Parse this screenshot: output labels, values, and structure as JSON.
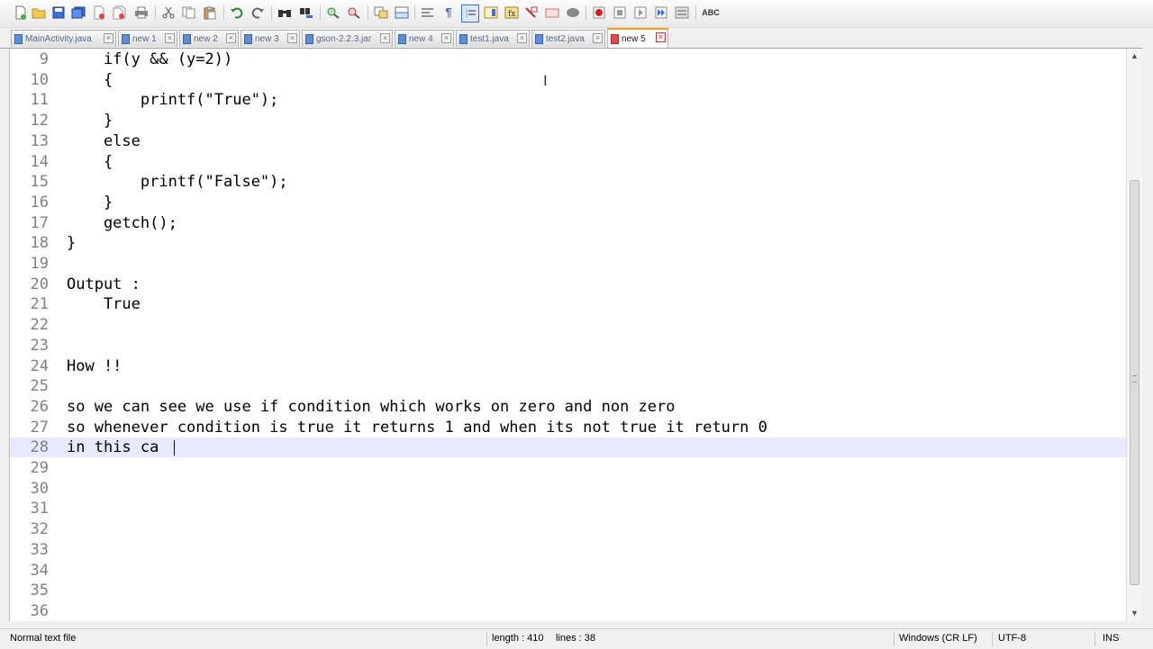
{
  "toolbar": {
    "icons": [
      "new-file-icon",
      "open-file-icon",
      "save-icon",
      "save-all-icon",
      "close-icon",
      "close-all-icon",
      "print-icon",
      "cut-icon",
      "copy-icon",
      "paste-icon",
      "undo-icon",
      "redo-icon",
      "find-icon",
      "replace-icon",
      "zoom-in-icon",
      "zoom-out-icon",
      "sync-vertical-icon",
      "sync-horizontal-icon",
      "word-wrap-icon",
      "show-all-chars-icon",
      "indent-guide-icon",
      "doc-map-icon",
      "function-list-icon",
      "folder-workspace-icon",
      "monitoring-icon",
      "macro-record-icon",
      "macro-stop-icon",
      "macro-play-icon",
      "macro-run-multiple-icon",
      "macro-save-icon",
      "spell-check-icon"
    ],
    "spell_label": "ABC"
  },
  "tabs": [
    {
      "label": "MainActivity.java",
      "active": false
    },
    {
      "label": "new 1",
      "active": false
    },
    {
      "label": "new 2",
      "active": false
    },
    {
      "label": "new 3",
      "active": false
    },
    {
      "label": "gson-2.2.3.jar",
      "active": false
    },
    {
      "label": "new 4",
      "active": false
    },
    {
      "label": "test1.java",
      "active": false
    },
    {
      "label": "test2.java",
      "active": false
    },
    {
      "label": "new 5",
      "active": true
    }
  ],
  "editor": {
    "lines": [
      {
        "n": "9",
        "text": "    if(y && (y=2))"
      },
      {
        "n": "10",
        "text": "    {"
      },
      {
        "n": "11",
        "text": "        printf(\"True\");"
      },
      {
        "n": "12",
        "text": "    }"
      },
      {
        "n": "13",
        "text": "    else"
      },
      {
        "n": "14",
        "text": "    {"
      },
      {
        "n": "15",
        "text": "        printf(\"False\");"
      },
      {
        "n": "16",
        "text": "    }"
      },
      {
        "n": "17",
        "text": "    getch();"
      },
      {
        "n": "18",
        "text": "}"
      },
      {
        "n": "19",
        "text": ""
      },
      {
        "n": "20",
        "text": "Output :"
      },
      {
        "n": "21",
        "text": "    True"
      },
      {
        "n": "22",
        "text": ""
      },
      {
        "n": "23",
        "text": ""
      },
      {
        "n": "24",
        "text": "How !!"
      },
      {
        "n": "25",
        "text": ""
      },
      {
        "n": "26",
        "text": "so we can see we use if condition which works on zero and non zero"
      },
      {
        "n": "27",
        "text": "so whenever condition is true it returns 1 and when its not true it return 0"
      },
      {
        "n": "28",
        "text": "in this ca"
      },
      {
        "n": "29",
        "text": ""
      },
      {
        "n": "30",
        "text": ""
      },
      {
        "n": "31",
        "text": ""
      },
      {
        "n": "32",
        "text": ""
      },
      {
        "n": "33",
        "text": ""
      },
      {
        "n": "34",
        "text": ""
      },
      {
        "n": "35",
        "text": ""
      },
      {
        "n": "36",
        "text": ""
      }
    ],
    "current_line": "28"
  },
  "status": {
    "file_type": "Normal text file",
    "length": "length : 410",
    "lines": "lines : 38",
    "eol": "Windows (CR LF)",
    "encoding": "UTF-8",
    "mode": "INS"
  }
}
